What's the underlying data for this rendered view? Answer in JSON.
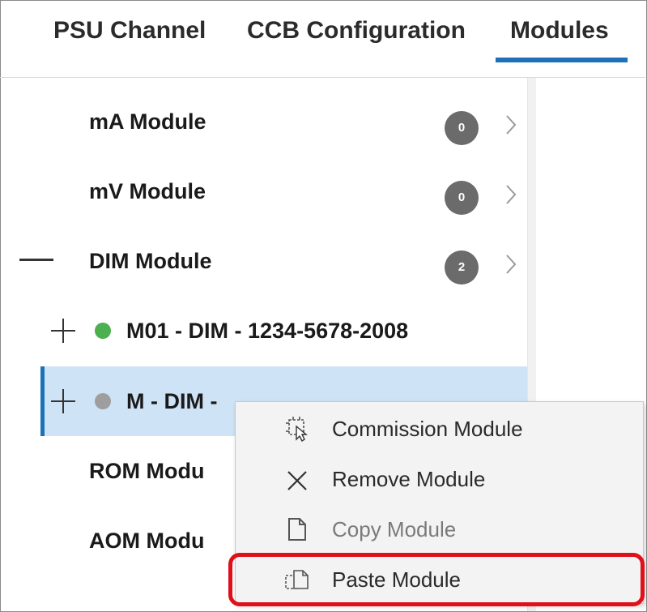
{
  "tabs": [
    {
      "label": "PSU Channel"
    },
    {
      "label": "CCB Configuration"
    },
    {
      "label": "Modules",
      "active": true
    }
  ],
  "tree": {
    "items": [
      {
        "label": "mA Module",
        "count": "0"
      },
      {
        "label": "mV Module",
        "count": "0"
      },
      {
        "label": "DIM Module",
        "count": "2",
        "expanded": true
      },
      {
        "label": "ROM Modu"
      },
      {
        "label": "AOM Modu"
      }
    ],
    "children": [
      {
        "label": "M01 - DIM - 1234-5678-2008",
        "status_color": "#4caf50"
      },
      {
        "label": "M - DIM -",
        "status_color": "#9e9e9e",
        "selected": true
      }
    ]
  },
  "context_menu": {
    "items": [
      {
        "label": "Commission Module",
        "icon": "commission-icon"
      },
      {
        "label": "Remove Module",
        "icon": "close-icon"
      },
      {
        "label": "Copy Module",
        "icon": "copy-icon",
        "disabled": true
      },
      {
        "label": "Paste Module",
        "icon": "paste-icon",
        "highlighted": true
      }
    ]
  },
  "colors": {
    "accent": "#1c71b8",
    "selection": "#cfe3f6",
    "badge": "#6b6b6b",
    "highlight": "#e0101a"
  }
}
